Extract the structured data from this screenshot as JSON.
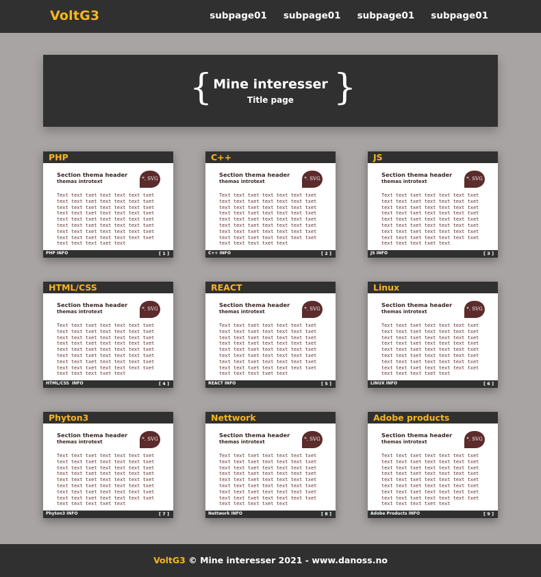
{
  "header": {
    "logo": "VoltG3",
    "nav": [
      "subpage01",
      "subpage01",
      "subpage01",
      "subpage01"
    ]
  },
  "hero": {
    "brace_left": "{",
    "brace_right": "}",
    "title": "Mine interesser",
    "subtitle": "Title page"
  },
  "cards": [
    {
      "title": "PHP",
      "section_header": "Section thema header",
      "intro": "themas introtext",
      "badge": "*. SVG",
      "text": "Text text txet text text text txet text text txet text text text txet text text txet text text text txet text text txet text text text txet text text txet text text text txet text text txet text text text txet text text txet text text text txet text text txet text text text txet text text text txet text",
      "footer_label": "PHP INFO",
      "footer_num": "[ 1 ]"
    },
    {
      "title": "C++",
      "section_header": "Section thema header",
      "intro": "themas introtext",
      "badge": "*. SVG",
      "text": "Text text txet text text text txet text text txet text text text txet text text txet text text text txet text text txet text text text txet text text txet text text text txet text text txet text text text txet text text txet text text text txet text text txet text text text txet text text text txet text",
      "footer_label": "C++ INFO",
      "footer_num": "[ 2 ]"
    },
    {
      "title": "JS",
      "section_header": "Section thema header",
      "intro": "themas introtext",
      "badge": "*. SVG",
      "text": "Text text txet text text text txet text text txet text text text txet text text txet text text text txet text text txet text text text txet text text txet text text text txet text text txet text text text txet text text txet text text text txet text text txet text text text txet text text text txet text",
      "footer_label": "JS INFO",
      "footer_num": "[ 3 ]"
    },
    {
      "title": "HTML/CSS",
      "section_header": "Section thema header",
      "intro": "themas introtext",
      "badge": "*. SVG",
      "text": "Text text txet text text text txet text text txet text text text txet text text txet text text text txet text text txet text text text txet text text txet text text text txet text text txet text text text txet text text txet text text text txet text text txet text text text txet text text text txet text",
      "footer_label": "HTML/CSS  INFO",
      "footer_num": "[ 4 ]"
    },
    {
      "title": "REACT",
      "section_header": "Section thema header",
      "intro": "themas introtext",
      "badge": "*. SVG",
      "text": "Text text txet text text text txet text text txet text text text txet text text txet text text text txet text text txet text text text txet text text txet text text text txet text text txet text text text txet text text txet text text text txet text text txet text text text txet text text text txet text",
      "footer_label": "REACT INFO",
      "footer_num": "[ 5 ]"
    },
    {
      "title": "Linux",
      "section_header": "Section thema header",
      "intro": "themas introtext",
      "badge": "*. SVG",
      "text": "Text text txet text text text txet text text txet text text text txet text text txet text text text txet text text txet text text text txet text text txet text text text txet text text txet text text text txet text text txet text text text txet text text txet text text text txet text text text txet text",
      "footer_label": "LINUX INFO",
      "footer_num": "[ 6 ]"
    },
    {
      "title": "Phyton3",
      "section_header": "Section thema header",
      "intro": "themas introtext",
      "badge": "*. SVG",
      "text": "Text text txet text text text txet text text txet text text text txet text text txet text text text txet text text txet text text text txet text text txet text text text txet text text txet text text text txet text text txet text text text txet text text txet text text text txet text text text txet text",
      "footer_label": "Phyton3 INFO",
      "footer_num": "[ 7 ]"
    },
    {
      "title": "Nettwork",
      "section_header": "Section thema header",
      "intro": "themas introtext",
      "badge": "*. SVG",
      "text": "Text text txet text text text txet text text txet text text text txet text text txet text text text txet text text txet text text text txet text text txet text text text txet text text txet text text text txet text text txet text text text txet text text txet text text text txet text text text txet text",
      "footer_label": "Nettwork INFO",
      "footer_num": "[ 8 ]"
    },
    {
      "title": "Adobe products",
      "section_header": "Section thema header",
      "intro": "themas introtext",
      "badge": "*. SVG",
      "text": "Text text txet text text text txet text text txet text text text txet text text txet text text text txet text text txet text text text txet text text txet text text text txet text text txet text text text txet text text txet text text text txet text text txet text text text txet text text text txet text",
      "footer_label": "Adobe Products INFO",
      "footer_num": "[ 9 ]"
    }
  ],
  "footer": {
    "brand": "VoltG3",
    "text": " © Mine interesser 2021 - www.danoss.no"
  },
  "colors": {
    "accent": "#f7b71d",
    "dark": "#303030",
    "background": "#a9a4a4",
    "badge": "#5c2b2b"
  }
}
